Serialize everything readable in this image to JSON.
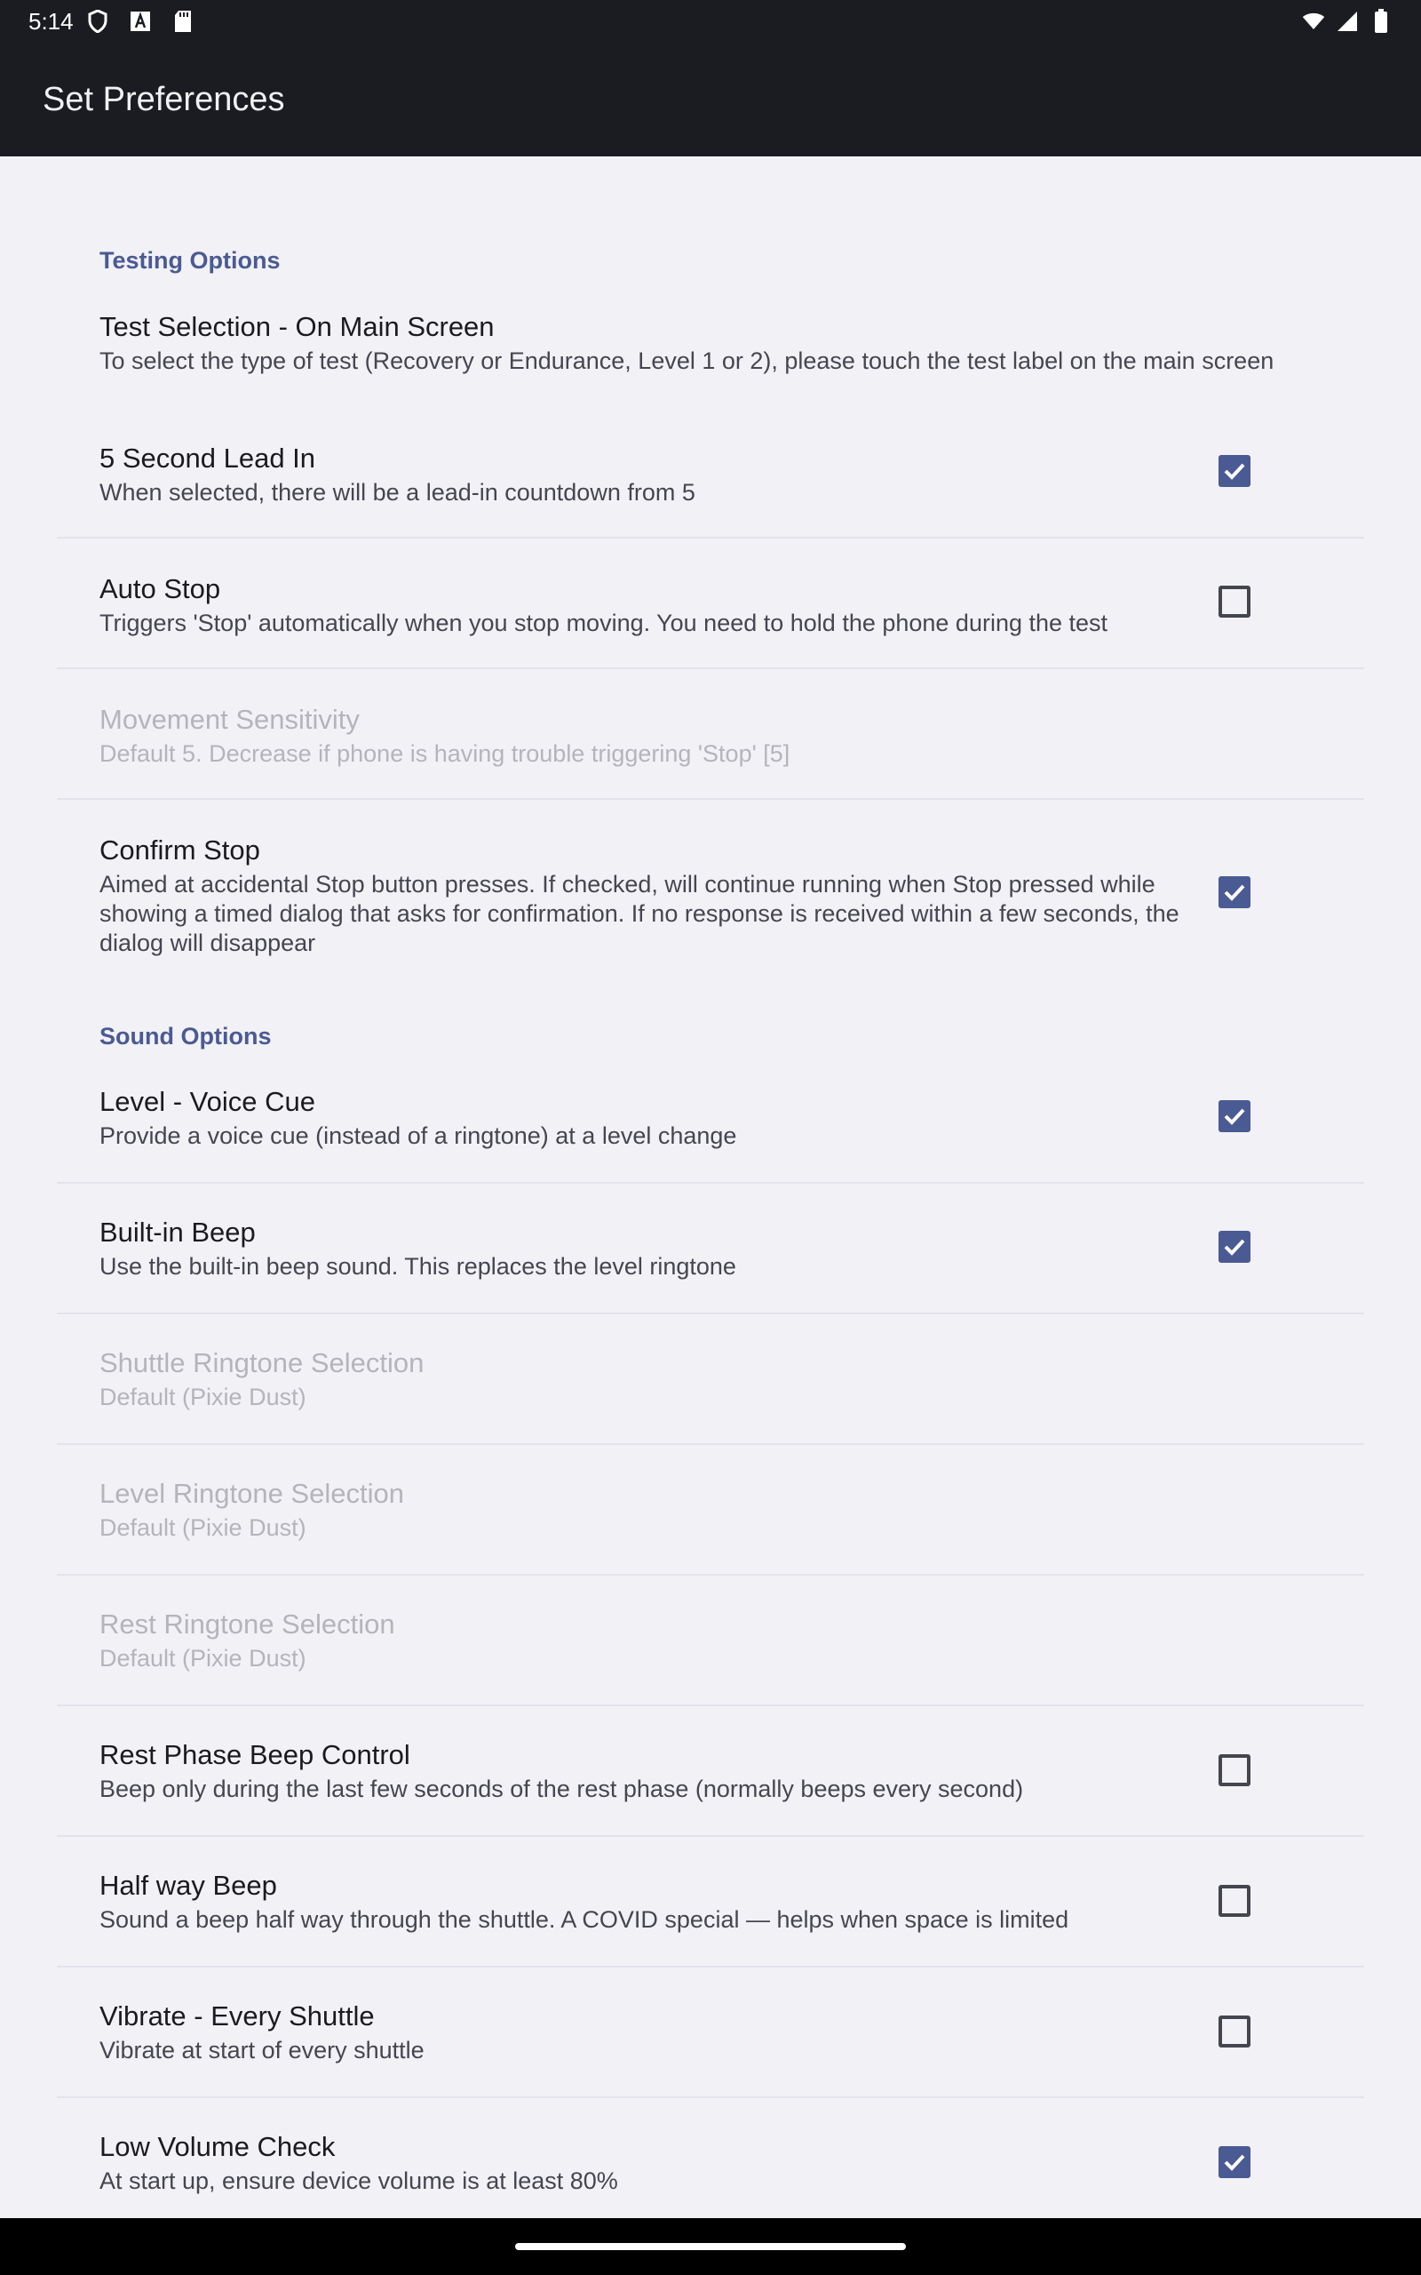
{
  "status_bar": {
    "time": "5:14",
    "left_icons": [
      "shield-icon",
      "font-a-icon",
      "sd-card-icon"
    ],
    "right_icons": [
      "wifi-icon",
      "signal-icon",
      "battery-icon"
    ]
  },
  "app_bar": {
    "title": "Set Preferences"
  },
  "sections": {
    "testing": {
      "header": "Testing Options"
    },
    "sound": {
      "header": "Sound Options"
    }
  },
  "prefs": [
    {
      "title": "Test Selection - On Main Screen",
      "summary": "To select the type of test (Recovery or Endurance, Level 1 or 2), please touch the test label on the main screen",
      "checkbox": null,
      "enabled": true
    },
    {
      "title": "5 Second Lead In",
      "summary": "When selected, there will be a lead-in countdown from 5",
      "checkbox": true,
      "enabled": true
    },
    {
      "title": "Auto Stop",
      "summary": "Triggers 'Stop' automatically when you stop moving. You need to hold the phone during the test",
      "checkbox": false,
      "enabled": true
    },
    {
      "title": "Movement Sensitivity",
      "summary": "Default 5. Decrease if phone is having trouble triggering 'Stop' [5]",
      "checkbox": null,
      "enabled": false
    },
    {
      "title": "Confirm Stop",
      "summary": "Aimed at accidental Stop button presses. If checked, will continue running when Stop pressed while showing a timed dialog that asks for confirmation. If no response is received within a few seconds, the dialog will disappear",
      "checkbox": true,
      "enabled": true
    },
    {
      "title": "Level - Voice Cue",
      "summary": "Provide a voice cue (instead of a ringtone) at a level change",
      "checkbox": true,
      "enabled": true
    },
    {
      "title": "Built-in Beep",
      "summary": "Use the built-in beep sound. This replaces the level ringtone",
      "checkbox": true,
      "enabled": true
    },
    {
      "title": "Shuttle Ringtone Selection",
      "summary": "Default (Pixie Dust)",
      "checkbox": null,
      "enabled": false
    },
    {
      "title": "Level Ringtone Selection",
      "summary": "Default (Pixie Dust)",
      "checkbox": null,
      "enabled": false
    },
    {
      "title": "Rest Ringtone Selection",
      "summary": "Default (Pixie Dust)",
      "checkbox": null,
      "enabled": false
    },
    {
      "title": "Rest Phase Beep Control",
      "summary": "Beep only during the last few seconds of the rest phase (normally beeps every second)",
      "checkbox": false,
      "enabled": true
    },
    {
      "title": "Half way Beep",
      "summary": "Sound a beep half way through the shuttle. A COVID special — helps when space is limited",
      "checkbox": false,
      "enabled": true
    },
    {
      "title": "Vibrate - Every Shuttle",
      "summary": "Vibrate at start of every shuttle",
      "checkbox": false,
      "enabled": true
    },
    {
      "title": "Low Volume Check",
      "summary": "At start up, ensure device volume is at least 80%",
      "checkbox": true,
      "enabled": true
    }
  ],
  "colors": {
    "accent": "#4a5a93",
    "bar_bg": "#1b1c22",
    "page_bg": "#f2f1f6",
    "disabled_text": "#b4b4bb"
  }
}
